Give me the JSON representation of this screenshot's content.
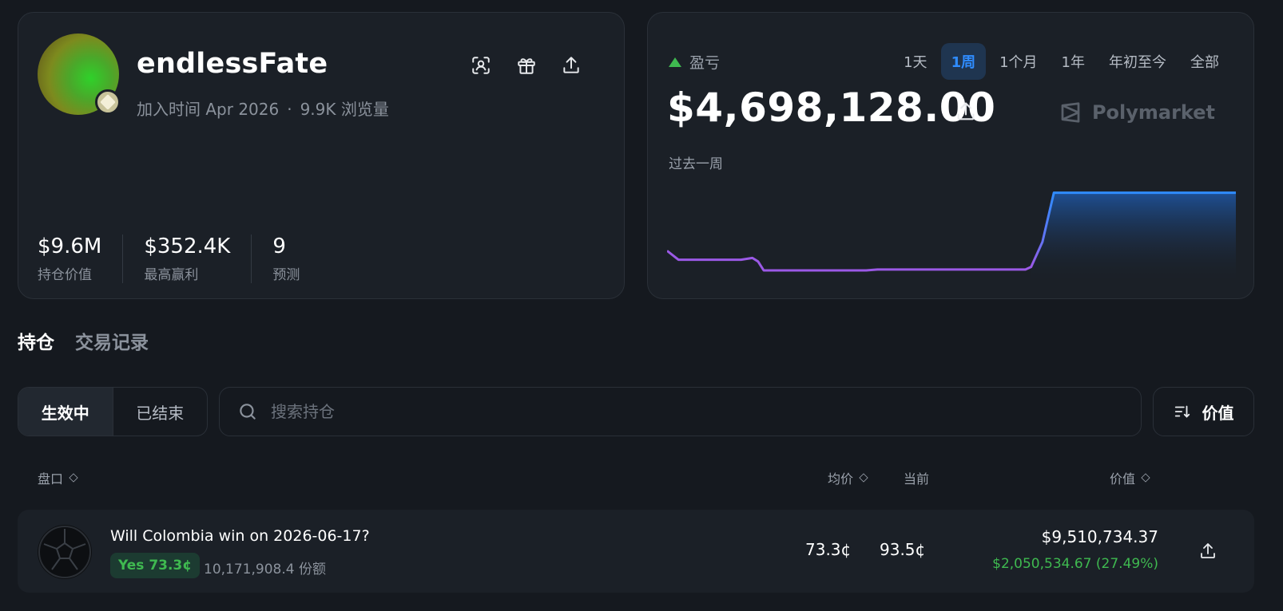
{
  "profile": {
    "username": "endlessFate",
    "joined": "加入时间 Apr 2026",
    "views": "9.9K 浏览量",
    "stats": [
      {
        "value": "$9.6M",
        "label": "持仓价值"
      },
      {
        "value": "$352.4K",
        "label": "最高赢利"
      },
      {
        "value": "9",
        "label": "预测"
      }
    ],
    "icons": [
      "scan-icon",
      "gift-icon",
      "share-icon"
    ]
  },
  "pnl": {
    "label": "盈亏",
    "value": "$4,698,128.00",
    "period": "过去一周",
    "brand": "Polymarket",
    "ranges": [
      "1天",
      "1周",
      "1个月",
      "1年",
      "年初至今",
      "全部"
    ],
    "active_range": "1周",
    "trend_color": "#3fb950",
    "line_colors": {
      "early": "#9b59e6",
      "late": "#2f8cff"
    }
  },
  "chart_data": {
    "type": "line",
    "x": [
      0,
      0.02,
      0.05,
      0.13,
      0.15,
      0.16,
      0.17,
      0.2,
      0.35,
      0.37,
      0.5,
      0.63,
      0.64,
      0.66,
      0.68,
      1.0
    ],
    "y": [
      0.3,
      0.2,
      0.2,
      0.2,
      0.22,
      0.18,
      0.08,
      0.08,
      0.08,
      0.09,
      0.09,
      0.09,
      0.12,
      0.4,
      0.95,
      0.95
    ],
    "title": "",
    "xlabel": "",
    "ylabel": ""
  },
  "tabs": [
    "持仓",
    "交易记录"
  ],
  "active_tab": "持仓",
  "filter": {
    "active": "生效中",
    "closed": "已结束"
  },
  "search": {
    "placeholder": "搜索持仓"
  },
  "sort": {
    "label": "价值"
  },
  "table": {
    "headers": {
      "market": "盘口",
      "avg": "均价",
      "current": "当前",
      "value": "价值"
    },
    "rows": [
      {
        "title": "Will Colombia win on 2026-06-17?",
        "outcome": "Yes 73.3¢",
        "shares": "10,171,908.4 份额",
        "avg": "73.3¢",
        "current": "93.5¢",
        "value": "$9,510,734.37",
        "pnl": "$2,050,534.67 (27.49%)"
      }
    ]
  }
}
